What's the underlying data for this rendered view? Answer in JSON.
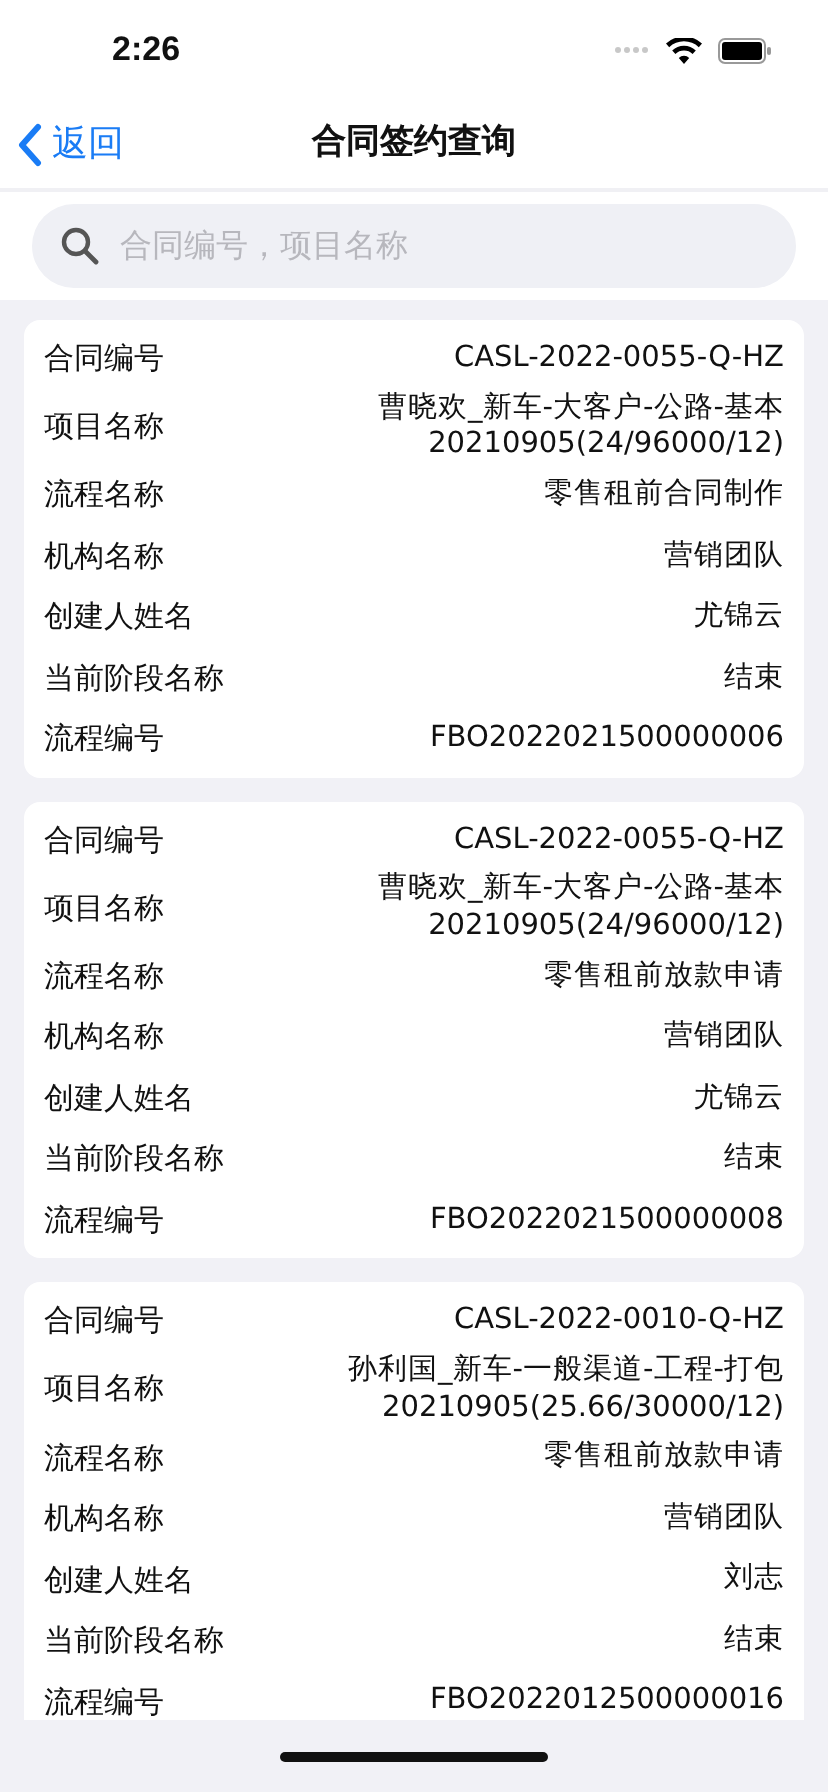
{
  "status_bar": {
    "time": "2:26"
  },
  "nav": {
    "back": "返回",
    "title": "合同签约查询"
  },
  "search": {
    "placeholder": "合同编号，项目名称"
  },
  "records": [
    {
      "fields": [
        {
          "label": "合同编号",
          "value": "CASL-2022-0055-Q-HZ"
        },
        {
          "label": "项目名称",
          "value": "曹晓欢_新车-大客户-公路-基本\n20210905(24/96000/12)"
        },
        {
          "label": "流程名称",
          "value": "零售租前合同制作"
        },
        {
          "label": "机构名称",
          "value": "营销团队"
        },
        {
          "label": "创建人姓名",
          "value": "尤锦云"
        },
        {
          "label": "当前阶段名称",
          "value": "结束"
        },
        {
          "label": "流程编号",
          "value": "FBO2022021500000006"
        }
      ]
    },
    {
      "fields": [
        {
          "label": "合同编号",
          "value": "CASL-2022-0055-Q-HZ"
        },
        {
          "label": "项目名称",
          "value": "曹晓欢_新车-大客户-公路-基本\n20210905(24/96000/12)"
        },
        {
          "label": "流程名称",
          "value": "零售租前放款申请"
        },
        {
          "label": "机构名称",
          "value": "营销团队"
        },
        {
          "label": "创建人姓名",
          "value": "尤锦云"
        },
        {
          "label": "当前阶段名称",
          "value": "结束"
        },
        {
          "label": "流程编号",
          "value": "FBO2022021500000008"
        }
      ]
    },
    {
      "fields": [
        {
          "label": "合同编号",
          "value": "CASL-2022-0010-Q-HZ"
        },
        {
          "label": "项目名称",
          "value": "孙利国_新车-一般渠道-工程-打包\n20210905(25.66/30000/12)"
        },
        {
          "label": "流程名称",
          "value": "零售租前放款申请"
        },
        {
          "label": "机构名称",
          "value": "营销团队"
        },
        {
          "label": "创建人姓名",
          "value": "刘志"
        },
        {
          "label": "当前阶段名称",
          "value": "结束"
        },
        {
          "label": "流程编号",
          "value": "FBO2022012500000016"
        }
      ]
    }
  ]
}
